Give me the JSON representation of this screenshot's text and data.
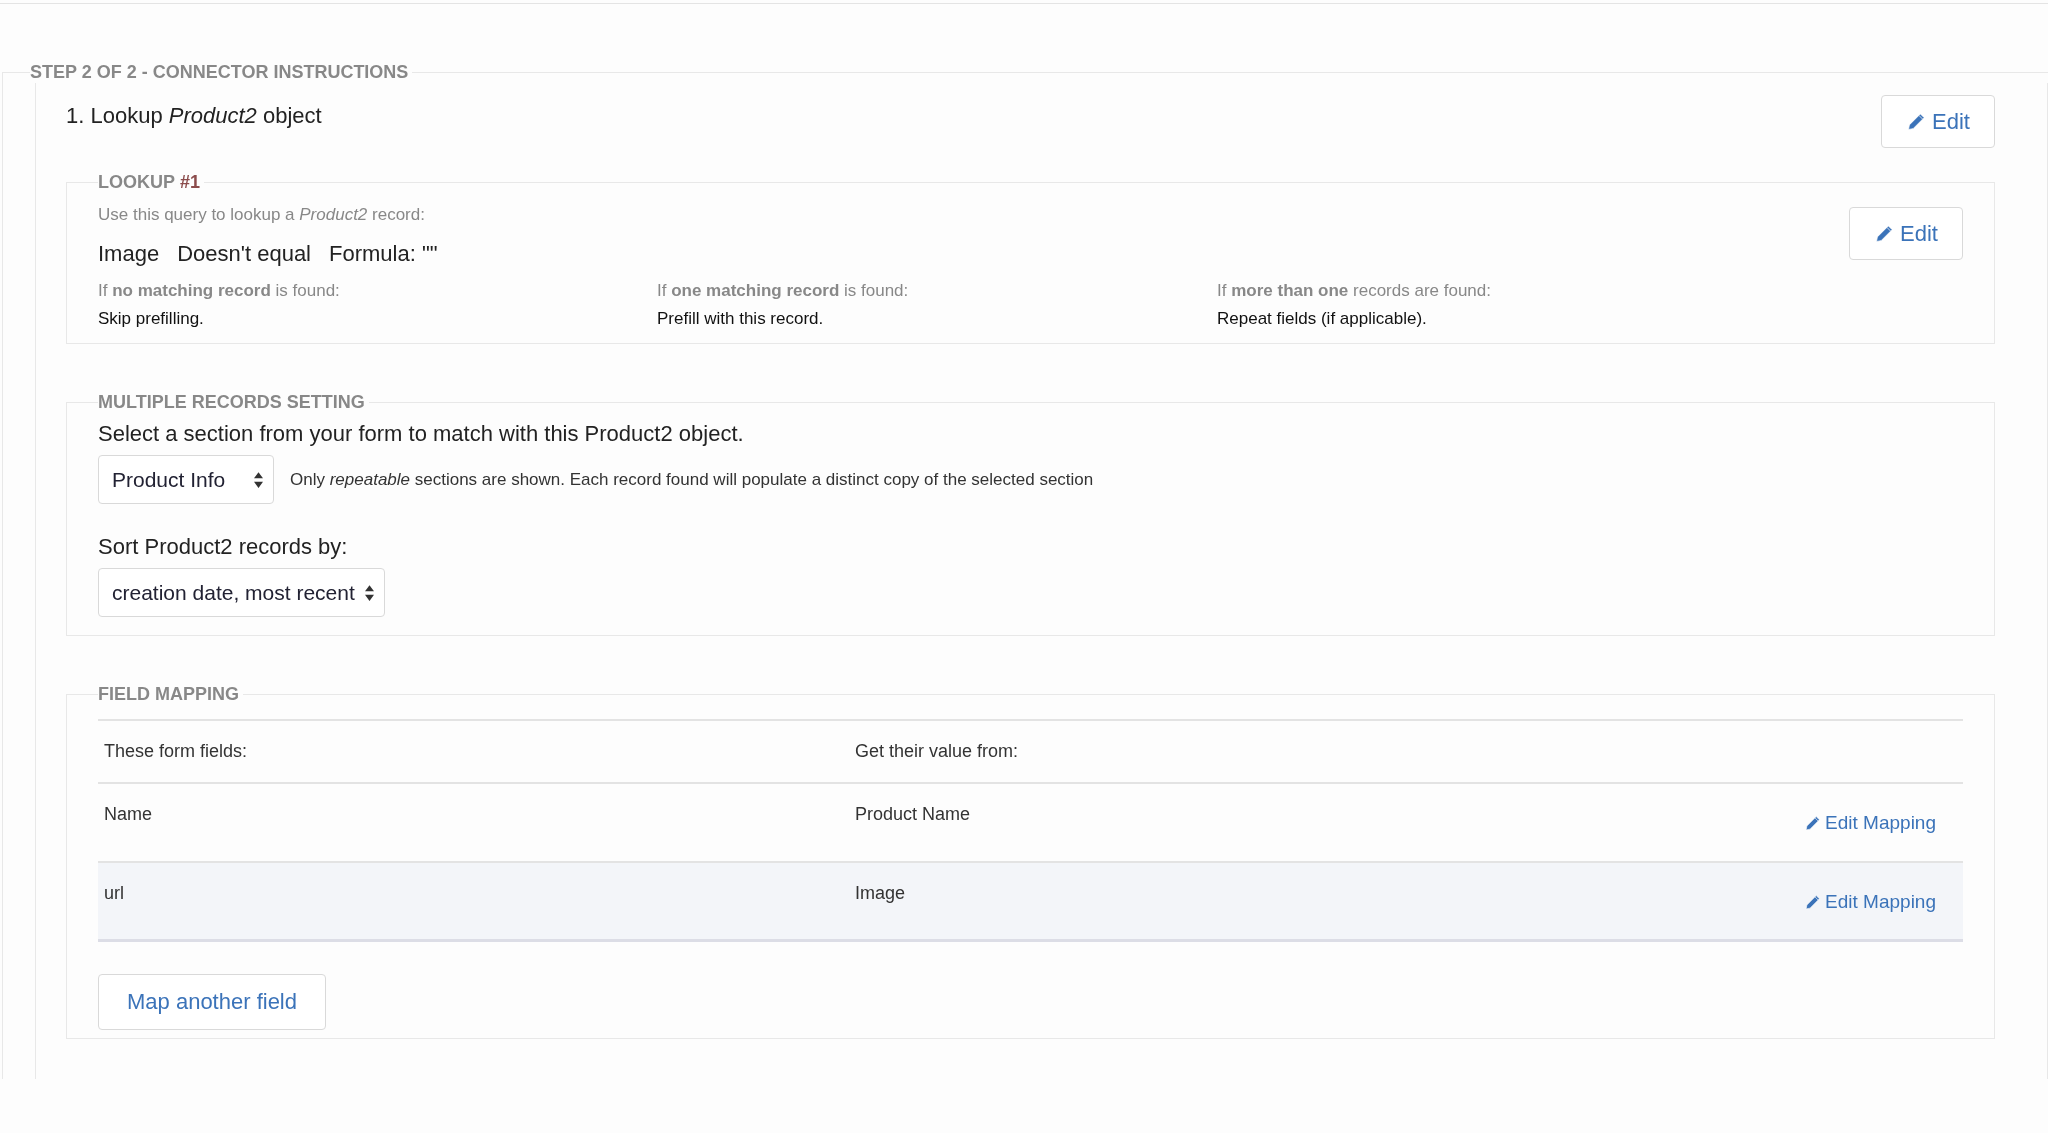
{
  "step_section": {
    "title": "STEP 2 OF 2 - CONNECTOR INSTRUCTIONS"
  },
  "instruction": {
    "heading": "1. Lookup *Product2* object",
    "edit_button": "Edit"
  },
  "lookup": {
    "title": "LOOKUP",
    "number": "#1",
    "intro": "Use this query to lookup a *Product2* record:",
    "query": [
      "Image",
      "Doesn't equal",
      "Formula: \"\""
    ],
    "edit_button": "Edit",
    "outcomes": [
      {
        "condition": "If **no matching record** is found:",
        "action": "Skip prefilling."
      },
      {
        "condition": "If **one matching record** is found:",
        "action": "Prefill with this record."
      },
      {
        "condition": "If **more than one** records are found:",
        "action": "Repeat fields (if applicable)."
      }
    ]
  },
  "multiple_records": {
    "title": "MULTIPLE RECORDS SETTING",
    "section_prompt": "Select a section from your form to match with this Product2 object.",
    "section_select": {
      "value": "Product Info"
    },
    "note": "Only *repeatable* sections are shown. Each record found will populate a distinct copy of the selected section",
    "sort_label": "Sort Product2 records by:",
    "sort_select": {
      "value": "creation date, most recent"
    }
  },
  "field_mapping": {
    "title": "FIELD MAPPING",
    "columns": [
      "These form fields:",
      "Get their value from:"
    ],
    "rows": [
      {
        "form_field": "Name",
        "source": "Product Name",
        "action": "Edit Mapping",
        "selected": false
      },
      {
        "form_field": "url",
        "source": "Image",
        "action": "Edit Mapping",
        "selected": true
      }
    ],
    "add_button": "Map another field"
  }
}
